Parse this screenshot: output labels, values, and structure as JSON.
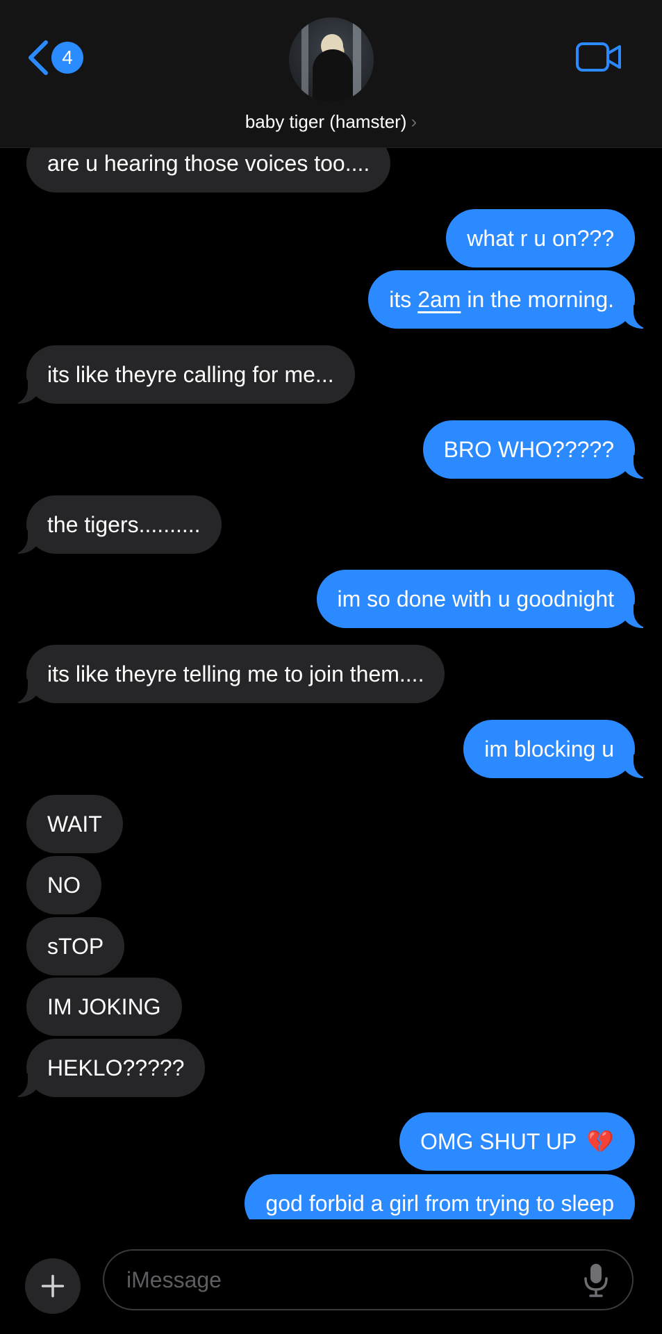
{
  "header": {
    "back_badge": "4",
    "contact_name": "baby tiger (hamster)",
    "contact_chevron": "›"
  },
  "messages": [
    {
      "from": "them",
      "text": "are u hearing those voices too...."
    },
    {
      "from": "me",
      "text": "what r u on???"
    },
    {
      "from": "me",
      "text_before": "its ",
      "text_link": "2am",
      "text_after": " in the morning."
    },
    {
      "from": "them",
      "text": "its like theyre calling for me..."
    },
    {
      "from": "me",
      "text": "BRO WHO?????"
    },
    {
      "from": "them",
      "text": "the tigers.........."
    },
    {
      "from": "me",
      "text": "im so done with u goodnight"
    },
    {
      "from": "them",
      "text": "its like theyre telling me to join them...."
    },
    {
      "from": "me",
      "text": "im blocking u"
    },
    {
      "from": "them",
      "text": "WAIT"
    },
    {
      "from": "them",
      "text": "NO"
    },
    {
      "from": "them",
      "text": "sTOP"
    },
    {
      "from": "them",
      "text": "IM JOKING"
    },
    {
      "from": "them",
      "text": "HEKLO?????"
    },
    {
      "from": "me",
      "text": "OMG SHUT UP",
      "emoji": "💔"
    },
    {
      "from": "me",
      "text": "god forbid a girl from trying to sleep"
    }
  ],
  "input": {
    "placeholder": "iMessage"
  },
  "icons": {
    "back": "chevron-left-icon",
    "video": "video-camera-icon",
    "plus": "plus-icon",
    "mic": "microphone-icon"
  },
  "colors": {
    "accent": "#2b8aff",
    "received_bubble": "#262628",
    "background": "#000000"
  }
}
